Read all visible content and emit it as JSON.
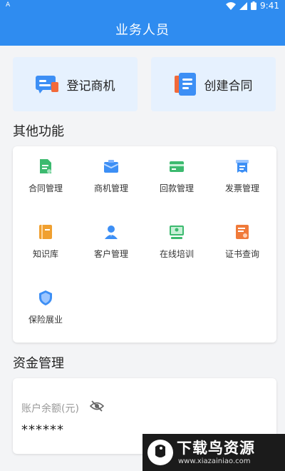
{
  "status_bar": {
    "left_glyph": "A",
    "time": "9:41"
  },
  "header": {
    "title": "业务人员"
  },
  "quick_actions": [
    {
      "label": "登记商机",
      "icon": "register-opportunity-icon"
    },
    {
      "label": "创建合同",
      "icon": "create-contract-icon"
    }
  ],
  "other_functions": {
    "title": "其他功能",
    "items": [
      {
        "label": "合同管理",
        "icon": "contract-icon",
        "color": "#3cba6f"
      },
      {
        "label": "商机管理",
        "icon": "briefcase-icon",
        "color": "#3d8ff5"
      },
      {
        "label": "回款管理",
        "icon": "payment-card-icon",
        "color": "#3cba6f"
      },
      {
        "label": "发票管理",
        "icon": "invoice-icon",
        "color": "#3d8ff5"
      },
      {
        "label": "知识库",
        "icon": "book-icon",
        "color": "#f0a030"
      },
      {
        "label": "客户管理",
        "icon": "customer-icon",
        "color": "#3d8ff5"
      },
      {
        "label": "在线培训",
        "icon": "training-icon",
        "color": "#3cba6f"
      },
      {
        "label": "证书查询",
        "icon": "certificate-icon",
        "color": "#f07a3a"
      },
      {
        "label": "保险展业",
        "icon": "insurance-shield-icon",
        "color": "#3d8ff5"
      }
    ]
  },
  "funds": {
    "title": "资金管理",
    "balance_label": "账户余额(元)",
    "balance_value": "******"
  },
  "watermark": {
    "title": "下载鸟资源",
    "url": "www.xiazainiao.com"
  },
  "colors": {
    "primary": "#2f8cf0",
    "quick_bg": "#e6f1fe"
  }
}
